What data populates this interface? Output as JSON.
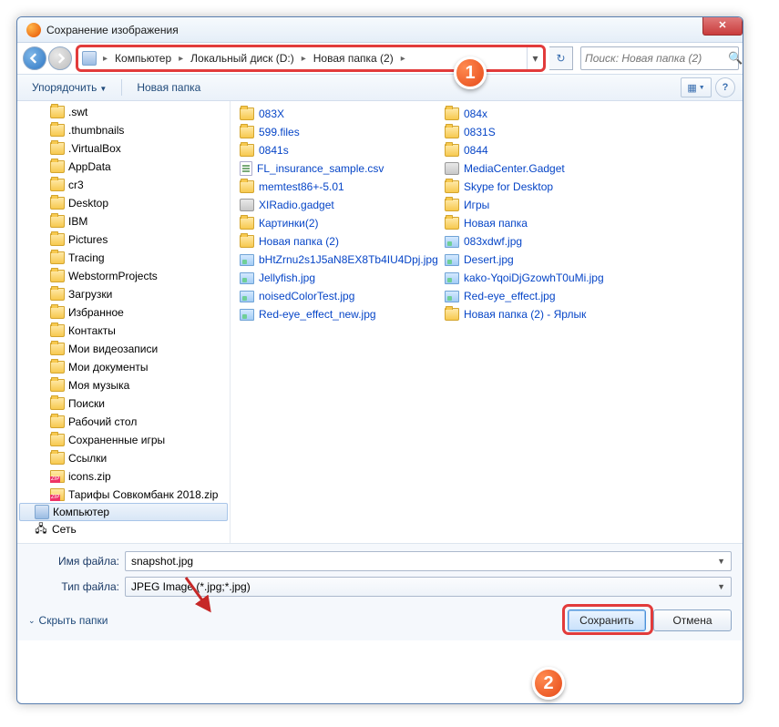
{
  "window": {
    "title": "Сохранение изображения"
  },
  "breadcrumbs": [
    "Компьютер",
    "Локальный диск (D:)",
    "Новая папка (2)"
  ],
  "search": {
    "placeholder": "Поиск: Новая папка (2)"
  },
  "toolbar": {
    "organize": "Упорядочить",
    "new_folder": "Новая папка"
  },
  "tree": [
    {
      "label": ".swt",
      "icon": "folder"
    },
    {
      "label": ".thumbnails",
      "icon": "folder"
    },
    {
      "label": ".VirtualBox",
      "icon": "folder"
    },
    {
      "label": "AppData",
      "icon": "folder"
    },
    {
      "label": "cr3",
      "icon": "folder"
    },
    {
      "label": "Desktop",
      "icon": "folder"
    },
    {
      "label": "IBM",
      "icon": "folder"
    },
    {
      "label": "Pictures",
      "icon": "folder"
    },
    {
      "label": "Tracing",
      "icon": "folder"
    },
    {
      "label": "WebstormProjects",
      "icon": "folder"
    },
    {
      "label": "Загрузки",
      "icon": "folder"
    },
    {
      "label": "Избранное",
      "icon": "folder"
    },
    {
      "label": "Контакты",
      "icon": "folder"
    },
    {
      "label": "Мои видеозаписи",
      "icon": "folder"
    },
    {
      "label": "Мои документы",
      "icon": "folder"
    },
    {
      "label": "Моя музыка",
      "icon": "folder"
    },
    {
      "label": "Поиски",
      "icon": "folder"
    },
    {
      "label": "Рабочий стол",
      "icon": "folder"
    },
    {
      "label": "Сохраненные игры",
      "icon": "folder"
    },
    {
      "label": "Ссылки",
      "icon": "folder"
    },
    {
      "label": "icons.zip",
      "icon": "zip"
    },
    {
      "label": "Тарифы Совкомбанк 2018.zip",
      "icon": "zip"
    },
    {
      "label": "Компьютер",
      "icon": "computer",
      "selected": true,
      "level": 0
    },
    {
      "label": "Сеть",
      "icon": "network",
      "level": 0
    }
  ],
  "files_col1": [
    {
      "label": "083X",
      "icon": "folder"
    },
    {
      "label": "599.files",
      "icon": "folder"
    },
    {
      "label": "0841s",
      "icon": "folder"
    },
    {
      "label": "FL_insurance_sample.csv",
      "icon": "csv"
    },
    {
      "label": "memtest86+-5.01",
      "icon": "folder"
    },
    {
      "label": "XIRadio.gadget",
      "icon": "gadget"
    },
    {
      "label": "Картинки(2)",
      "icon": "folder"
    },
    {
      "label": "Новая папка (2)",
      "icon": "folder"
    },
    {
      "label": "bHtZrnu2s1J5aN8EX8Tb4IU4Dpj.jpg",
      "icon": "image"
    },
    {
      "label": "Jellyfish.jpg",
      "icon": "image"
    },
    {
      "label": "noisedColorTest.jpg",
      "icon": "image"
    },
    {
      "label": "Red-eye_effect_new.jpg",
      "icon": "image"
    }
  ],
  "files_col2": [
    {
      "label": "084x",
      "icon": "folder"
    },
    {
      "label": "0831S",
      "icon": "folder"
    },
    {
      "label": "0844",
      "icon": "folder"
    },
    {
      "label": "MediaCenter.Gadget",
      "icon": "gadget"
    },
    {
      "label": "Skype for Desktop",
      "icon": "folder"
    },
    {
      "label": "Игры",
      "icon": "folder"
    },
    {
      "label": "Новая папка",
      "icon": "folder"
    },
    {
      "label": "083xdwf.jpg",
      "icon": "image"
    },
    {
      "label": "Desert.jpg",
      "icon": "image"
    },
    {
      "label": "kako-YqoiDjGzowhT0uMi.jpg",
      "icon": "image"
    },
    {
      "label": "Red-eye_effect.jpg",
      "icon": "image"
    },
    {
      "label": "Новая папка (2) - Ярлык",
      "icon": "shortcut"
    }
  ],
  "form": {
    "filename_label": "Имя файла:",
    "filename_value": "snapshot.jpg",
    "filetype_label": "Тип файла:",
    "filetype_value": "JPEG Image (*.jpg;*.jpg)"
  },
  "buttons": {
    "hide_folders": "Скрыть папки",
    "save": "Сохранить",
    "cancel": "Отмена"
  },
  "annotations": {
    "badge1": "1",
    "badge2": "2"
  }
}
